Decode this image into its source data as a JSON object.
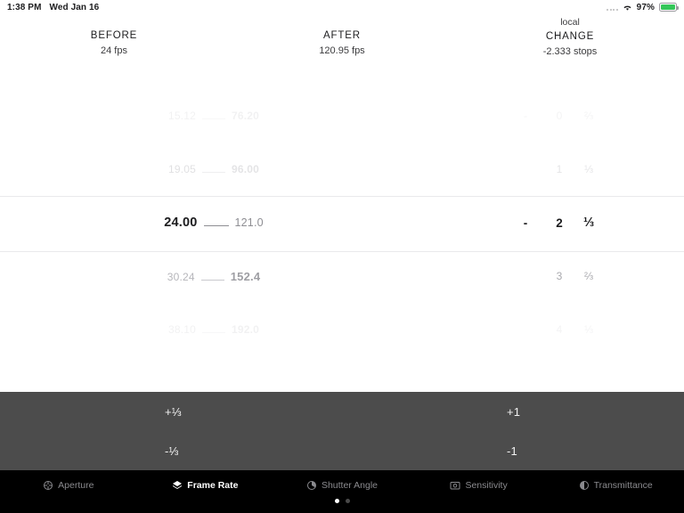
{
  "status_bar": {
    "time": "1:38 PM",
    "date": "Wed Jan 16",
    "battery_percent": "97%",
    "wifi_icon": "wifi-icon",
    "battery_icon": "battery-icon",
    "signal_icon": "signal-dots-icon",
    "battery_color": "#34c759"
  },
  "header": {
    "before": {
      "title": "BEFORE",
      "value": "24 fps"
    },
    "after": {
      "title": "AFTER",
      "value": "120.95 fps"
    },
    "change": {
      "superlabel": "local",
      "title": "CHANGE",
      "value": "-2.333 stops"
    }
  },
  "picker": {
    "frame_rate_rows": [
      {
        "before": "15.12",
        "after": "76.20",
        "state": "farther"
      },
      {
        "before": "19.05",
        "after": "96.00",
        "state": "far"
      },
      {
        "before": "24.00",
        "after": "121.0",
        "state": "selected"
      },
      {
        "before": "30.24",
        "after": "152.4",
        "state": "near"
      },
      {
        "before": "38.10",
        "after": "192.0",
        "state": "farther"
      }
    ],
    "stop_rows": [
      {
        "sign": "-",
        "whole": "0",
        "fraction": "⅔",
        "state": "farther"
      },
      {
        "sign": "",
        "whole": "1",
        "fraction": "⅓",
        "state": "far"
      },
      {
        "sign": "-",
        "whole": "2",
        "fraction": "⅓",
        "state": "selected"
      },
      {
        "sign": "",
        "whole": "3",
        "fraction": "⅔",
        "state": "near"
      },
      {
        "sign": "",
        "whole": "4",
        "fraction": "⅓",
        "state": "farther"
      }
    ]
  },
  "adjust_pad": {
    "plus_third": "+⅓",
    "minus_third": "-⅓",
    "plus_one": "+1",
    "minus_one": "-1",
    "background": "#4c4c4c"
  },
  "tabs": [
    {
      "label": "Aperture",
      "icon": "aperture-icon",
      "active": false
    },
    {
      "label": "Frame Rate",
      "icon": "frame-rate-icon",
      "active": true
    },
    {
      "label": "Shutter Angle",
      "icon": "shutter-angle-icon",
      "active": false
    },
    {
      "label": "Sensitivity",
      "icon": "sensitivity-icon",
      "active": false
    },
    {
      "label": "Transmittance",
      "icon": "transmittance-icon",
      "active": false
    }
  ],
  "page_dots": {
    "count": 2,
    "active_index": 0
  }
}
